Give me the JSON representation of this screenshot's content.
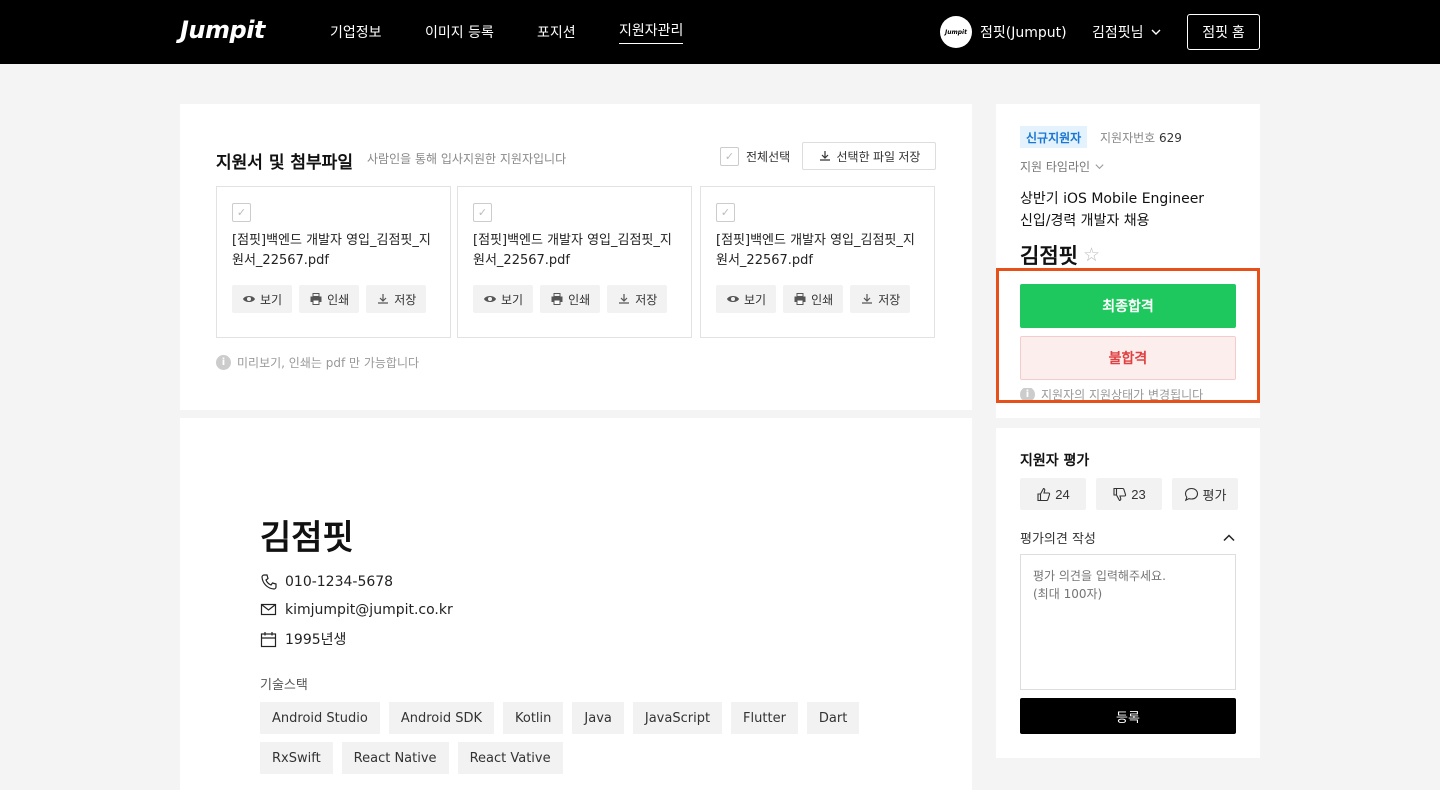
{
  "header": {
    "logo": "Jumpit",
    "nav": [
      "기업정보",
      "이미지 등록",
      "포지션",
      "지원자관리"
    ],
    "company_avatar": "Jumpit",
    "company_name": "점핏(Jumput)",
    "user_name": "김점핏님",
    "home_button": "점핏 홈"
  },
  "files": {
    "title": "지원서 및 첨부파일",
    "subtitle": "사람인을 통해 입사지원한 지원자입니다",
    "select_all": "전체선택",
    "save_selected": "선택한 파일 저장",
    "items": [
      {
        "name": "[점핏]백엔드 개발자 영입_김점핏_지원서_22567.pdf"
      },
      {
        "name": "[점핏]백엔드 개발자 영입_김점핏_지원서_22567.pdf"
      },
      {
        "name": "[점핏]백엔드 개발자 영입_김점핏_지원서_22567.pdf"
      }
    ],
    "actions": {
      "view": "보기",
      "print": "인쇄",
      "save": "저장"
    },
    "note": "미리보기, 인쇄는 pdf 만 가능합니다"
  },
  "resume": {
    "name": "김점핏",
    "phone": "010-1234-5678",
    "email": "kimjumpit@jumpit.co.kr",
    "birth": "1995년생",
    "skills_label": "기술스택",
    "skills": [
      "Android Studio",
      "Android SDK",
      "Kotlin",
      "Java",
      "JavaScript",
      "Flutter",
      "Dart",
      "RxSwift",
      "React Native",
      "React Vative"
    ]
  },
  "applicant": {
    "badge": "신규지원자",
    "number_label": "지원자번호",
    "number": "629",
    "timeline": "지원 타임라인",
    "job_title_line1": "상반기 iOS Mobile Engineer",
    "job_title_line2": "신입/경력 개발자 채용",
    "name": "김점핏",
    "pass_button": "최종합격",
    "fail_button": "불합격",
    "status_note": "지원자의 지원상태가 변경됩니다"
  },
  "evaluation": {
    "title": "지원자 평가",
    "likes": "24",
    "dislikes": "23",
    "comment_label": "평가",
    "opinion_title": "평가의견 작성",
    "opinion_placeholder": "평가 의견을 입력해주세요.\n(최대 100자)",
    "submit": "등록"
  },
  "colors": {
    "pass": "#1fc85f",
    "fail_text": "#e04040",
    "highlight": "#e8501a",
    "badge_text": "#1976d2"
  }
}
